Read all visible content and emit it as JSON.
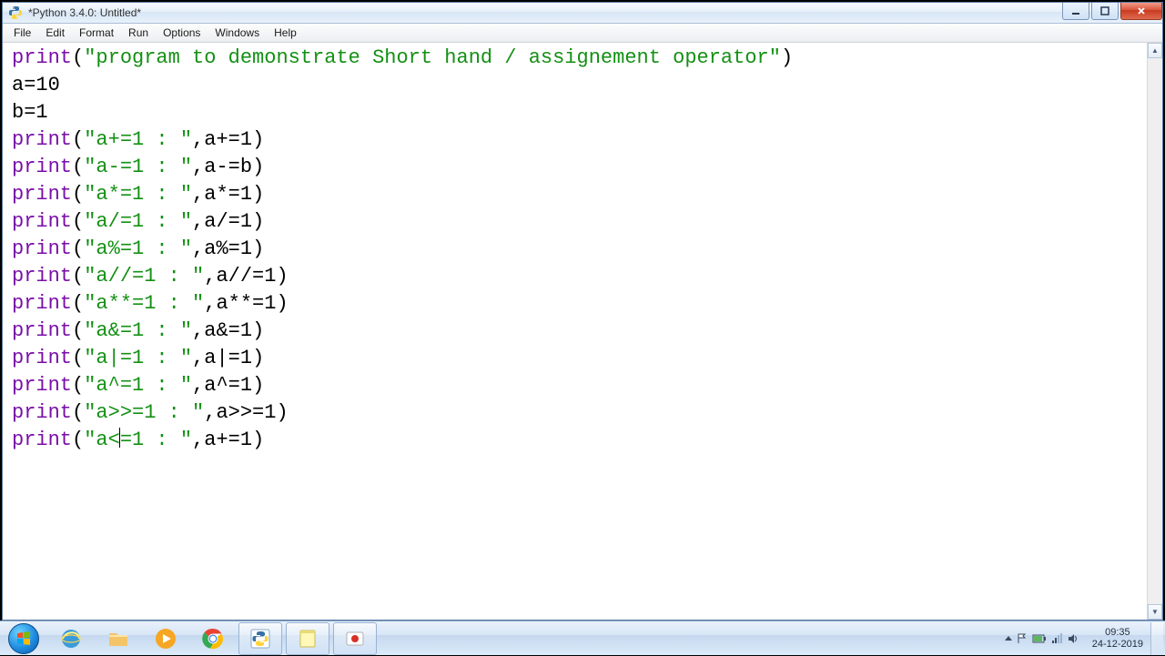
{
  "window": {
    "title": "*Python 3.4.0: Untitled*"
  },
  "menu": {
    "file": "File",
    "edit": "Edit",
    "format": "Format",
    "run": "Run",
    "options": "Options",
    "windows": "Windows",
    "help": "Help"
  },
  "code": {
    "l1_call": "print",
    "l1_open": "(",
    "l1_str": "\"program to demonstrate Short hand / assignement operator\"",
    "l1_close": ")",
    "l2": "a=10",
    "l3": "b=1",
    "l4_call": "print",
    "l4_open": "(",
    "l4_str": "\"a+=1 : \"",
    "l4_mid": ",a+=1",
    "l4_close": ")",
    "l5_call": "print",
    "l5_open": "(",
    "l5_str": "\"a-=1 : \"",
    "l5_mid": ",a-=b",
    "l5_close": ")",
    "l6_call": "print",
    "l6_open": "(",
    "l6_str": "\"a*=1 : \"",
    "l6_mid": ",a*=1",
    "l6_close": ")",
    "l7_call": "print",
    "l7_open": "(",
    "l7_str": "\"a/=1 : \"",
    "l7_mid": ",a/=1",
    "l7_close": ")",
    "l8_call": "print",
    "l8_open": "(",
    "l8_str": "\"a%=1 : \"",
    "l8_mid": ",a%=1",
    "l8_close": ")",
    "l9_call": "print",
    "l9_open": "(",
    "l9_str": "\"a//=1 : \"",
    "l9_mid": ",a//=1",
    "l9_close": ")",
    "l10_call": "print",
    "l10_open": "(",
    "l10_str": "\"a**=1 : \"",
    "l10_mid": ",a**=1",
    "l10_close": ")",
    "l11_call": "print",
    "l11_open": "(",
    "l11_str": "\"a&=1 : \"",
    "l11_mid": ",a&=1",
    "l11_close": ")",
    "l12_call": "print",
    "l12_open": "(",
    "l12_str": "\"a|=1 : \"",
    "l12_mid": ",a|=1",
    "l12_close": ")",
    "l13_call": "print",
    "l13_open": "(",
    "l13_str": "\"a^=1 : \"",
    "l13_mid": ",a^=1",
    "l13_close": ")",
    "l14_call": "print",
    "l14_open": "(",
    "l14_str": "\"a>>=1 : \"",
    "l14_mid": ",a>>=1",
    "l14_close": ")",
    "l15_call": "print",
    "l15_open": "(",
    "l15_strA": "\"a<",
    "l15_strB": "=1 : \"",
    "l15_mid": ",a+=1",
    "l15_close": ")"
  },
  "tray": {
    "time": "09:35",
    "date": "24-12-2019"
  }
}
